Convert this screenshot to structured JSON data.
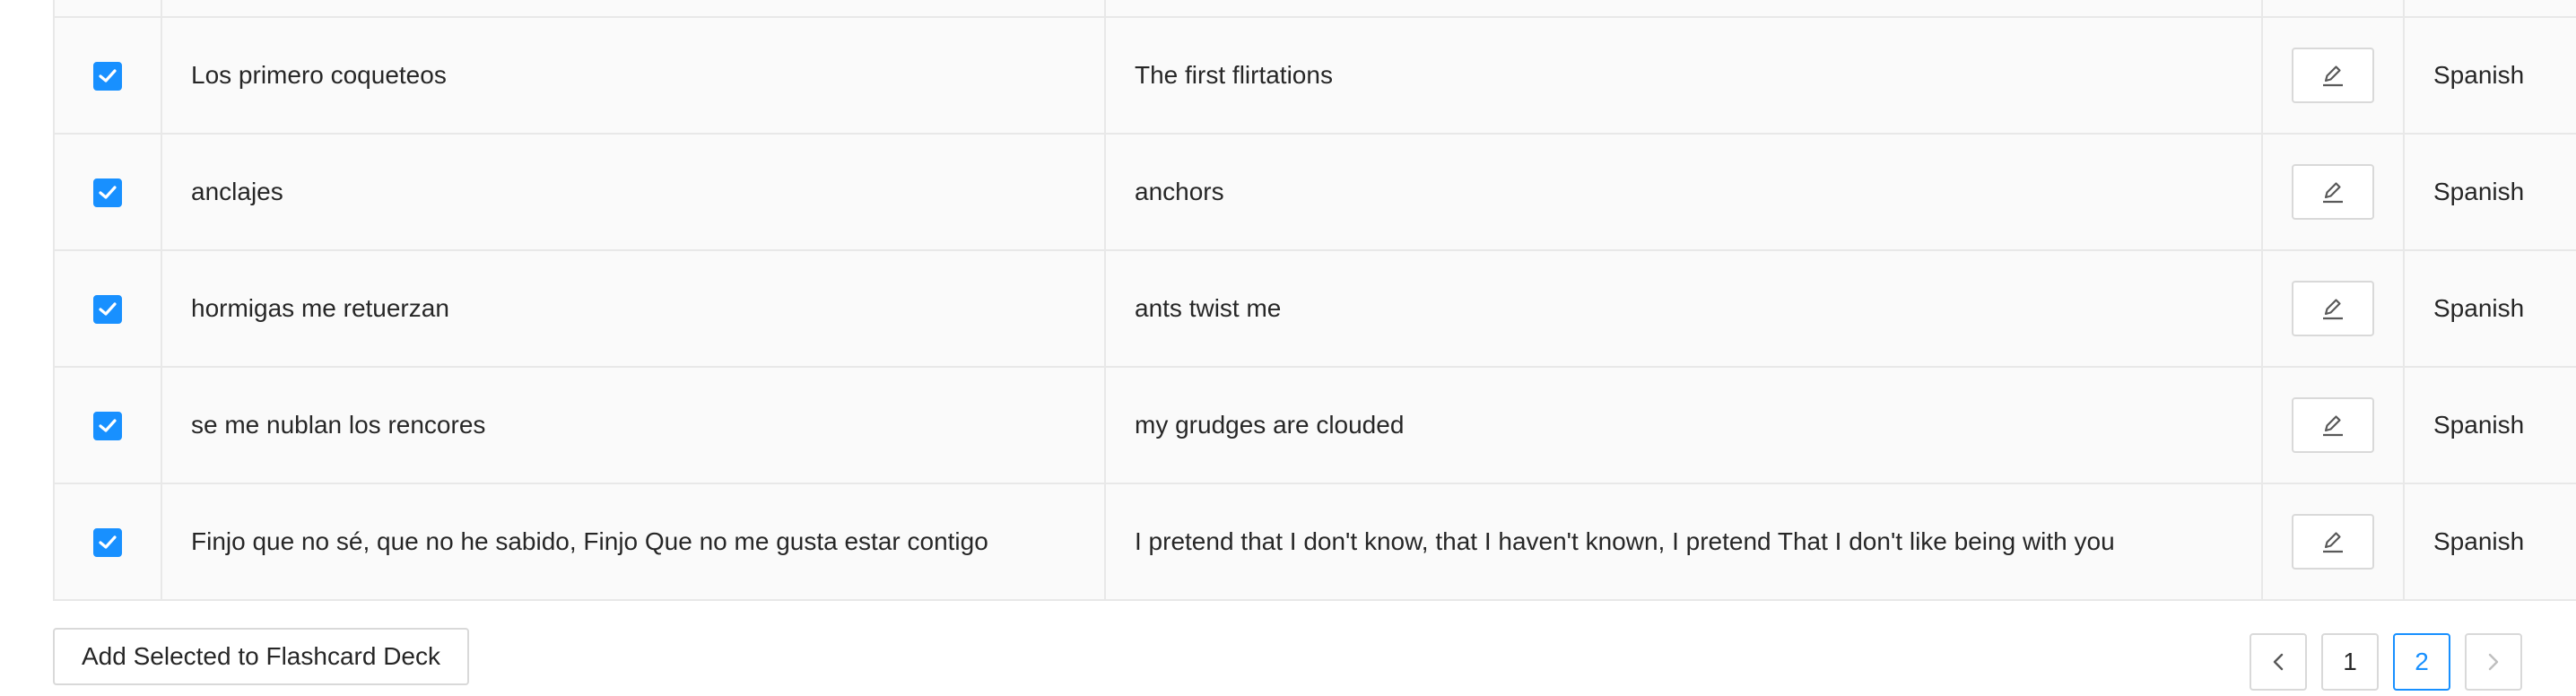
{
  "table": {
    "rows": [
      {
        "source": "Los primero coqueteos",
        "translation": "The first flirtations",
        "language": "Spanish",
        "checked": true
      },
      {
        "source": "anclajes",
        "translation": "anchors",
        "language": "Spanish",
        "checked": true
      },
      {
        "source": "hormigas me retuerzan",
        "translation": "ants twist me",
        "language": "Spanish",
        "checked": true
      },
      {
        "source": "se me nublan los rencores",
        "translation": "my grudges are clouded",
        "language": "Spanish",
        "checked": true
      },
      {
        "source": "Finjo que no sé, que no he sabido, Finjo Que no me gusta estar contigo",
        "translation": "I pretend that I don't know, that I haven't known, I pretend That I don't like being with you",
        "language": "Spanish",
        "checked": true
      }
    ]
  },
  "actions": {
    "add_to_deck_label": "Add Selected to Flashcard Deck"
  },
  "pagination": {
    "pages": [
      "1",
      "2"
    ],
    "current": "2",
    "prev_icon": "chevron-left-icon",
    "next_icon": "chevron-right-icon"
  },
  "colors": {
    "accent": "#1890ff",
    "border": "#e8e8e8",
    "row_bg": "#fafafa"
  }
}
